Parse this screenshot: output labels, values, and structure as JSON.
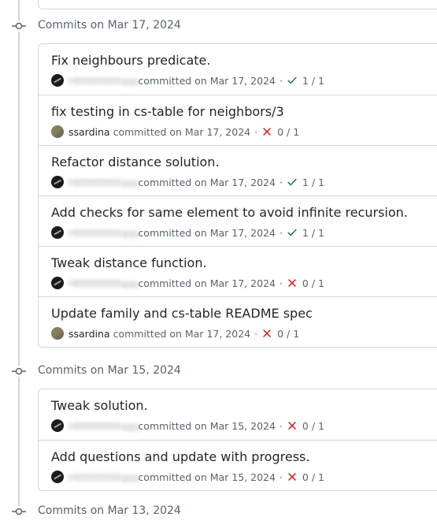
{
  "groups": [
    {
      "title": "Commits on Mar 17, 2024",
      "commits": [
        {
          "message": "Fix neighbours predicate.",
          "author": "Htttttttttttttqqq",
          "author_hidden": true,
          "avatar": "dark",
          "committed": "committed on Mar 17, 2024",
          "status": "success",
          "count": "1 / 1"
        },
        {
          "message": "fix testing in cs-table for neighbors/3",
          "author": "ssardina",
          "author_hidden": false,
          "avatar": "photo",
          "committed": "committed on Mar 17, 2024",
          "status": "failure",
          "count": "0 / 1"
        },
        {
          "message": "Refactor distance solution.",
          "author": "Htttttttttttttqqq",
          "author_hidden": true,
          "avatar": "dark",
          "committed": "committed on Mar 17, 2024",
          "status": "success",
          "count": "1 / 1"
        },
        {
          "message": "Add checks for same element to avoid infinite recursion.",
          "author": "Htttttttttttttqqq",
          "author_hidden": true,
          "avatar": "dark",
          "committed": "committed on Mar 17, 2024",
          "status": "success",
          "count": "1 / 1"
        },
        {
          "message": "Tweak distance function.",
          "author": "Htttttttttttttqqq",
          "author_hidden": true,
          "avatar": "dark",
          "committed": "committed on Mar 17, 2024",
          "status": "failure",
          "count": "0 / 1"
        },
        {
          "message": "Update family and cs-table README spec",
          "author": "ssardina",
          "author_hidden": false,
          "avatar": "photo",
          "committed": "committed on Mar 17, 2024",
          "status": "failure",
          "count": "0 / 1"
        }
      ]
    },
    {
      "title": "Commits on Mar 15, 2024",
      "commits": [
        {
          "message": "Tweak solution.",
          "author": "Htttttttttttttqqq",
          "author_hidden": true,
          "avatar": "dark",
          "committed": "committed on Mar 15, 2024",
          "status": "failure",
          "count": "0 / 1"
        },
        {
          "message": "Add questions and update with progress.",
          "author": "Htttttttttttttqqq",
          "author_hidden": true,
          "avatar": "dark",
          "committed": "committed on Mar 15, 2024",
          "status": "failure",
          "count": "0 / 1"
        }
      ]
    },
    {
      "title": "Commits on Mar 13, 2024",
      "commits": []
    }
  ],
  "colors": {
    "success": "#1a7f37",
    "failure": "#d1242f",
    "border": "#d0d7de",
    "muted": "#59636e"
  }
}
